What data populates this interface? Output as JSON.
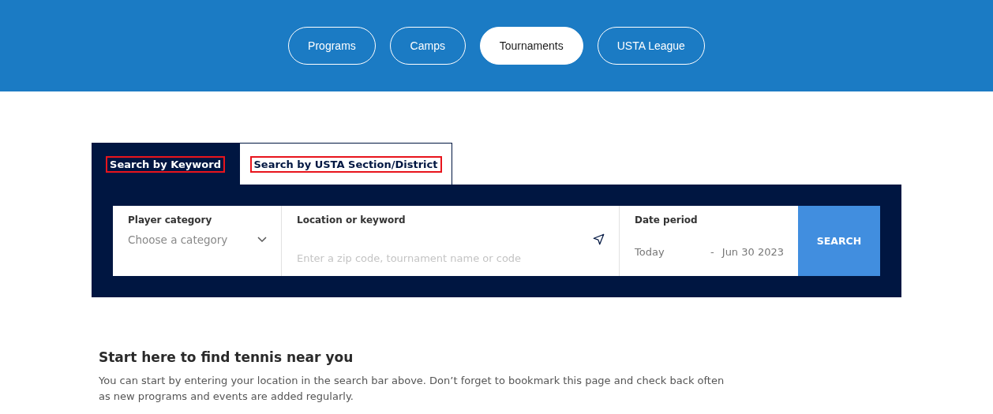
{
  "nav_pills": [
    {
      "label": "Programs",
      "selected": false
    },
    {
      "label": "Camps",
      "selected": false
    },
    {
      "label": "Tournaments",
      "selected": true
    },
    {
      "label": "USTA League",
      "selected": false
    }
  ],
  "search_tabs": [
    {
      "label": "Search by Keyword",
      "selected": true
    },
    {
      "label": "Search by USTA Section/District",
      "selected": false
    }
  ],
  "search_bar": {
    "player_category": {
      "label": "Player category",
      "placeholder": "Choose a category"
    },
    "location": {
      "label": "Location or keyword",
      "placeholder": "Enter a zip code, tournament name or code"
    },
    "date_period": {
      "label": "Date period",
      "from": "Today",
      "separator": "-",
      "to": "Jun 30 2023"
    },
    "button": "SEARCH"
  },
  "intro": {
    "heading": "Start here to find tennis near you",
    "text": "You can start by entering your location in the search bar above. Don’t forget to bookmark this page and check back often as new programs and events are added regularly."
  }
}
